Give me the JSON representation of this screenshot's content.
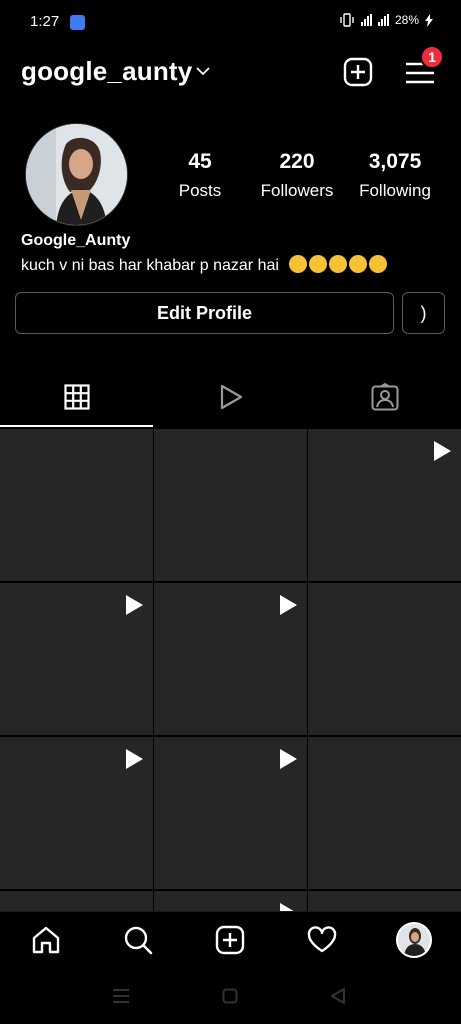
{
  "status_bar": {
    "time": "1:27",
    "battery": "28%"
  },
  "header": {
    "username": "google_aunty",
    "notification_count": "1"
  },
  "profile": {
    "stats": [
      {
        "value": "45",
        "label": "Posts"
      },
      {
        "value": "220",
        "label": "Followers"
      },
      {
        "value": "3,075",
        "label": "Following"
      }
    ],
    "display_name": "Google_Aunty",
    "bio": "kuch v ni bas har khabar p nazar hai"
  },
  "buttons": {
    "edit_profile": "Edit Profile",
    "secondary": ")"
  },
  "tabs": [
    {
      "icon": "grid-icon",
      "active": true
    },
    {
      "icon": "reels-icon",
      "active": false
    },
    {
      "icon": "tagged-icon",
      "active": false
    }
  ],
  "grid": {
    "cells": [
      {
        "video": false
      },
      {
        "video": false
      },
      {
        "video": true
      },
      {
        "video": true
      },
      {
        "video": true
      },
      {
        "video": false
      },
      {
        "video": true
      },
      {
        "video": true
      },
      {
        "video": false
      },
      {
        "video": false
      },
      {
        "video": true
      },
      {
        "video": false
      }
    ]
  },
  "bottom_nav": [
    "home-icon",
    "search-icon",
    "create-icon",
    "activity-icon",
    "profile-avatar"
  ],
  "colors": {
    "background": "#000000",
    "cell": "#262626",
    "badge": "#ee2c3c"
  }
}
